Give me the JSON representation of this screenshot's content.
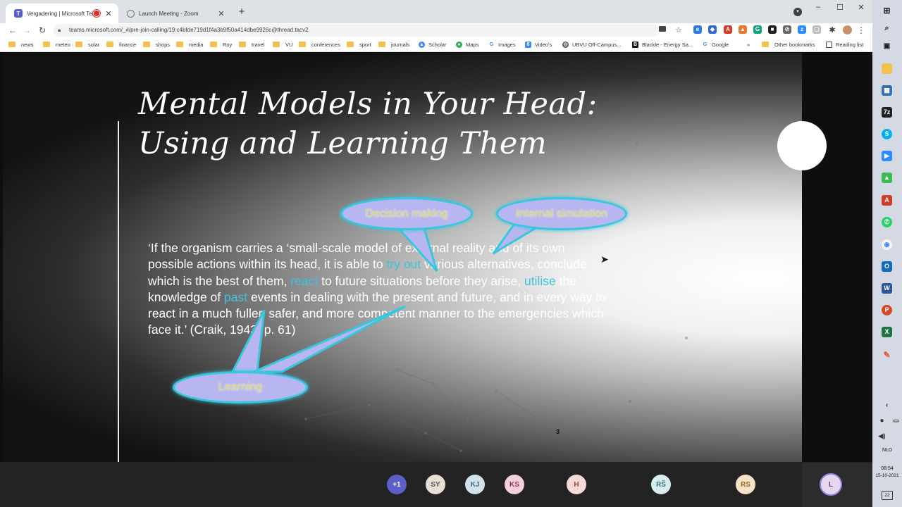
{
  "browser": {
    "tabs": [
      {
        "title": "Vergadering | Microsoft Tea",
        "active": true,
        "recording": true
      },
      {
        "title": "Launch Meeting - Zoom",
        "active": false
      }
    ],
    "new_tab": "+",
    "url": "teams.microsoft.com/_#/pre-join-calling/19:c4bfde719d1f4a3b9f50a414dbe9926c@thread.tacv2",
    "bookmarks": [
      "news",
      "meteo",
      "solar",
      "finance",
      "shops",
      "media",
      "Roy",
      "travel",
      "VU",
      "conferences",
      "sport",
      "journals",
      "Scholar",
      "Maps",
      "Images",
      "Video's",
      "UBVU Off-Campus...",
      "Blackle - Energy Sa...",
      "Google"
    ],
    "more_bookmarks": "»",
    "other_bookmarks": "Other bookmarks",
    "reading_list": "Reading list",
    "window_controls": {
      "minimize": "–",
      "maximize": "☐",
      "close": "✕"
    }
  },
  "slide": {
    "title_line1": "Mental Models in Your Head:",
    "title_line2": "Using and Learning Them",
    "quote": {
      "p1": "‘If the organism carries a ‘small-scale model of external reality and of its own possible actions within its head, it is able to ",
      "hl1": "try out",
      "p2": " various alternatives, conclude which is the best of them, ",
      "hl2": "react",
      "p3": " to future situations before they arise, ",
      "hl3": "utilise",
      "p4": " the knowledge of ",
      "hl4": "past",
      "p5": " events in dealing with the present and future, and in every way to react in a much fuller, safer, and more competent manner to the emergencies which face it.’ (Craik, 1943, p. 61)"
    },
    "callouts": {
      "decision": "Decision making",
      "internal": "Internal simulation",
      "learning": "Learning"
    },
    "page_number": "3"
  },
  "participants": [
    {
      "initials": "+1",
      "color": "#5b5fc7",
      "text_color": "#ffffff"
    },
    {
      "initials": "SY",
      "color": "#e8e0d4",
      "text_color": "#555555"
    },
    {
      "initials": "KJ",
      "color": "#cfe3ec",
      "text_color": "#4a6a7a"
    },
    {
      "initials": "KS",
      "color": "#f5d0dc",
      "text_color": "#8a3a55"
    },
    {
      "initials": "H",
      "color": "#f7d9d6",
      "text_color": "#8a4a44"
    },
    {
      "initials": "RŠ",
      "color": "#d6eef0",
      "text_color": "#3e6f76"
    },
    {
      "initials": "RS",
      "color": "#f6e2c4",
      "text_color": "#8a6a33"
    },
    {
      "initials": "L",
      "color": "#e6d6ef",
      "text_color": "#5e4a78"
    }
  ],
  "system_tray": {
    "language": "NLD",
    "time": "08:54",
    "date": "15-10-2021",
    "notifications": "22"
  }
}
